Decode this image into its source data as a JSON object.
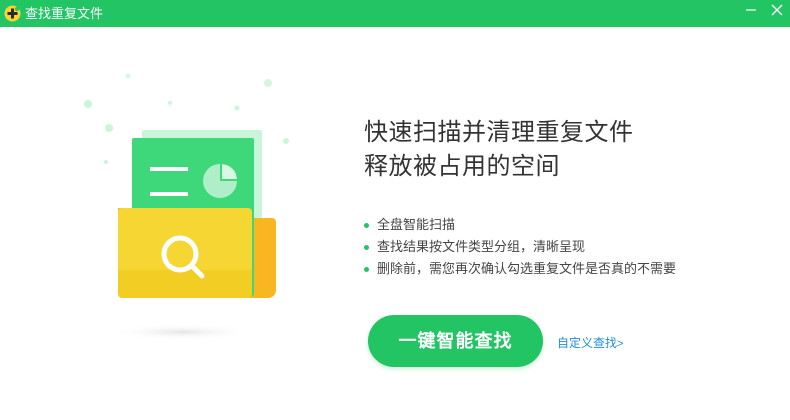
{
  "window": {
    "title": "查找重复文件",
    "titlebar_color": "#22c464",
    "logo_icon": "plus-badge-icon",
    "controls": {
      "minimize_icon": "minimize-icon",
      "close_icon": "close-icon"
    }
  },
  "illustration": {
    "description_icon": "folder-search-icon",
    "colors": {
      "doc": "#3ed87a",
      "folder": "#f5d633",
      "folder_back": "#f8b720",
      "paper": "#c9f5d9"
    }
  },
  "main": {
    "headline": [
      "快速扫描并清理重复文件",
      "释放被占用的空间"
    ],
    "features": [
      "全盘智能扫描",
      "查找结果按文件类型分组，清晰呈现",
      "删除前，需您再次确认勾选重复文件是否真的不需要"
    ],
    "primary_button": "一键智能查找",
    "custom_link": "自定义查找",
    "custom_link_arrow": ">"
  },
  "colors": {
    "accent": "#22c464",
    "link": "#1f8fd8",
    "text": "#333333"
  }
}
